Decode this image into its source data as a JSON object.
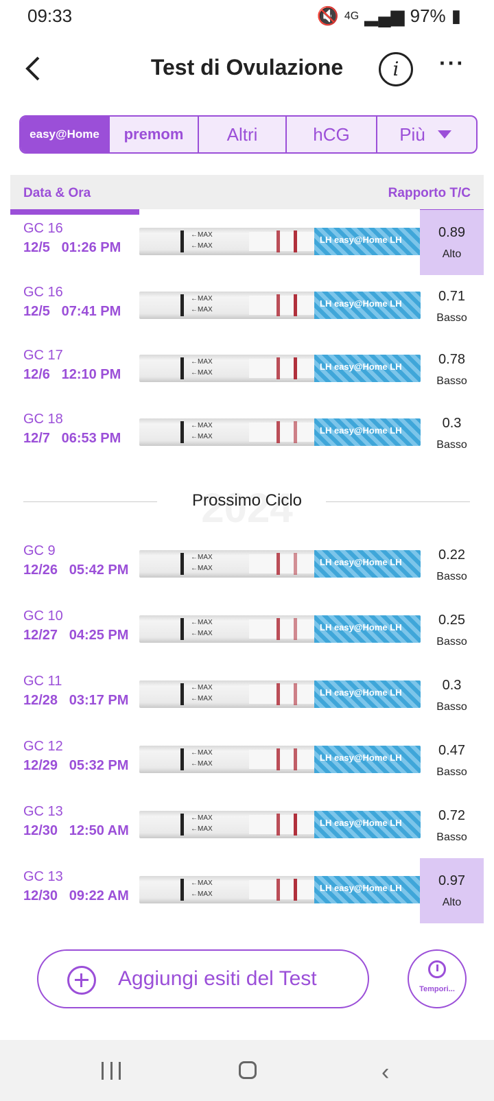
{
  "status_bar": {
    "time": "09:33",
    "network": "4G",
    "battery": "97%"
  },
  "header": {
    "title": "Test di Ovulazione",
    "info_label": "i",
    "more_label": "···"
  },
  "tabs": [
    {
      "label": "easy@Home"
    },
    {
      "label": "premom"
    },
    {
      "label": "Altri"
    },
    {
      "label": "hCG"
    },
    {
      "label": "Più"
    }
  ],
  "columns": {
    "left": "Data & Ora",
    "right": "Rapporto T/C"
  },
  "strip_text": {
    "max": "←MAX",
    "brand": "LH easy@Home LH"
  },
  "rows_cycle1": [
    {
      "cd": "GC 16",
      "datetime": "12/5   01:26 PM",
      "ratio": "0.89",
      "level": "Alto"
    },
    {
      "cd": "GC 16",
      "datetime": "12/5   07:41 PM",
      "ratio": "0.71",
      "level": "Basso"
    },
    {
      "cd": "GC 17",
      "datetime": "12/6   12:10 PM",
      "ratio": "0.78",
      "level": "Basso"
    },
    {
      "cd": "GC 18",
      "datetime": "12/7   06:53 PM",
      "ratio": "0.3",
      "level": "Basso"
    }
  ],
  "separator": {
    "label": "Prossimo Ciclo",
    "watermark": "2024"
  },
  "rows_cycle2": [
    {
      "cd": "GC 9",
      "datetime": "12/26   05:42 PM",
      "ratio": "0.22",
      "level": "Basso"
    },
    {
      "cd": "GC 10",
      "datetime": "12/27   04:25 PM",
      "ratio": "0.25",
      "level": "Basso"
    },
    {
      "cd": "GC 11",
      "datetime": "12/28   03:17 PM",
      "ratio": "0.3",
      "level": "Basso"
    },
    {
      "cd": "GC 12",
      "datetime": "12/29   05:32 PM",
      "ratio": "0.47",
      "level": "Basso"
    },
    {
      "cd": "GC 13",
      "datetime": "12/30   12:50 AM",
      "ratio": "0.72",
      "level": "Basso"
    },
    {
      "cd": "GC 13",
      "datetime": "12/30   09:22 AM",
      "ratio": "0.97",
      "level": "Alto"
    }
  ],
  "actions": {
    "add_label": "Aggiungi esiti del Test",
    "timer_label": "Tempori..."
  },
  "colors": {
    "accent": "#9b4fd8",
    "high_bg": "#dcc8f4",
    "strip_blue": "#3fa6d9"
  }
}
